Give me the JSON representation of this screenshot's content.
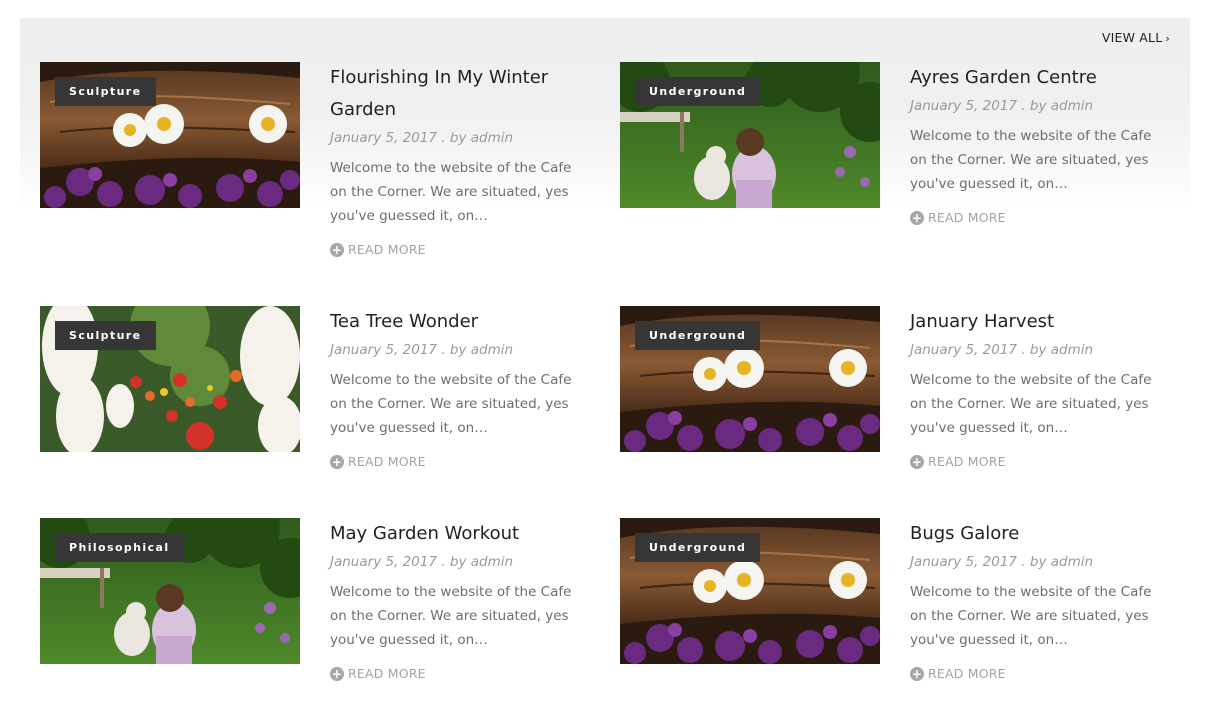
{
  "view_all": {
    "label": "VIEW ALL",
    "icon": "chevron-right-icon"
  },
  "posts": [
    {
      "category": "Sculpture",
      "title": "Flourishing In My Winter Garden",
      "date": "January 5, 2017",
      "author": "by admin",
      "excerpt": "Welcome to the website of the Cafe on the Corner. We are situated, yes you've guessed it, on…",
      "read_more": "READ MORE",
      "image": "daisies on log"
    },
    {
      "category": "Underground",
      "title": "Ayres Garden Centre",
      "date": "January 5, 2017",
      "author": "by admin",
      "excerpt": "Welcome to the website of the Cafe on the Corner. We are situated, yes you've guessed it, on…",
      "read_more": "READ MORE",
      "image": "girl with dog"
    },
    {
      "category": "Sculpture",
      "title": "Tea Tree Wonder",
      "date": "January 5, 2017",
      "author": "by admin",
      "excerpt": "Welcome to the website of the Cafe on the Corner. We are situated, yes you've guessed it, on…",
      "read_more": "READ MORE",
      "image": "flower garden"
    },
    {
      "category": "Underground",
      "title": "January Harvest",
      "date": "January 5, 2017",
      "author": "by admin",
      "excerpt": "Welcome to the website of the Cafe on the Corner. We are situated, yes you've guessed it, on…",
      "read_more": "READ MORE",
      "image": "daisies on log"
    },
    {
      "category": "Philosophical",
      "title": "May Garden Workout",
      "date": "January 5, 2017",
      "author": "by admin",
      "excerpt": "Welcome to the website of the Cafe on the Corner. We are situated, yes you've guessed it, on…",
      "read_more": "READ MORE",
      "image": "girl with dog"
    },
    {
      "category": "Underground",
      "title": "Bugs Galore",
      "date": "January 5, 2017",
      "author": "by admin",
      "excerpt": "Welcome to the website of the Cafe on the Corner. We are situated, yes you've guessed it, on…",
      "read_more": "READ MORE",
      "image": "daisies on log"
    }
  ],
  "colors": {
    "category_bg": "#363636",
    "title": "#222222",
    "meta": "#9a9a9a",
    "excerpt": "#6e6e6e",
    "read_more": "#a3a3a3"
  }
}
